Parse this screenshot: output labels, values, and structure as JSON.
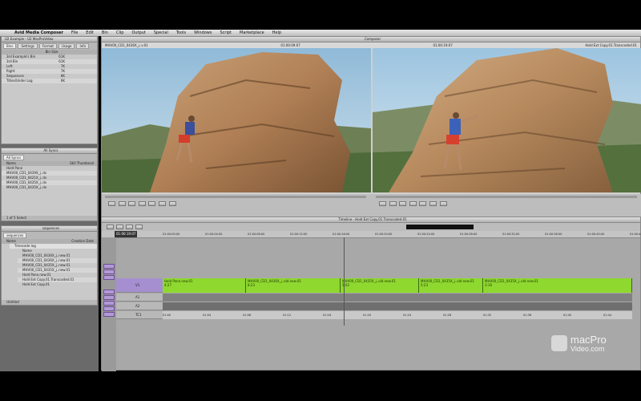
{
  "app": {
    "name": "Avid Media Composer",
    "menus": [
      "File",
      "Edit",
      "Bin",
      "Clip",
      "Output",
      "Special",
      "Tools",
      "Windows",
      "Script",
      "Marketplace",
      "Help"
    ]
  },
  "project_panel": {
    "title": "U2 Example - U2 MacProVideo",
    "tabs": [
      "Bins",
      "Settings",
      "Format",
      "Usage",
      "Info"
    ],
    "header": "Bin Size",
    "rows": [
      {
        "label": "3rd Example's Bin",
        "value": "61K"
      },
      {
        "label": "3rd Bin",
        "value": "61K"
      },
      {
        "label": "Left",
        "value": "7K"
      },
      {
        "label": "Right",
        "value": "7K"
      },
      {
        "label": "Sequences",
        "value": "8K"
      },
      {
        "label": "Titles/Under Log",
        "value": "6K"
      }
    ]
  },
  "bin1": {
    "title": "All Syncs",
    "tab": "All Syncs",
    "header_name": "Name",
    "header_extra": "Still Thumbnail",
    "items": [
      "Hold Pane",
      "MHV00_CD1_0439X_j..dv",
      "MHV00_CD1_0421X_j..dv",
      "MHV00_CD1_0435X_j..dv",
      "MHV00_CD1_0435X_j..dv"
    ],
    "footer": "1 of 5 Select"
  },
  "bin2": {
    "title": "sequences",
    "tab": "sequences",
    "header_name": "Name",
    "header_extra": "Creation Date",
    "group_label": "Timecode log",
    "subheader": "Name",
    "items": [
      "MHV00_CD1_0436X_j..new.01",
      "MHV00_CD1_0436X_j..new.01",
      "MHV00_CD1_0435X_j..new.01",
      "MHV00_CD1_0435X_j..new.01",
      "Hold Pane.new.01",
      "Hold Ext Copy.01.Transcoded.01",
      "Hold Ext Copy.01"
    ],
    "footer": "Untitled"
  },
  "composer": {
    "title": "Composer",
    "source_label": "MHV00_CD1_0436X_j..v.01",
    "source_tc": "01:00:09:07",
    "record_tc": "01:00:19:07",
    "record_label": "Hold Ext Copy.01.Transcoded.01"
  },
  "timeline": {
    "title": "Timeline - Hold Ext Copy.01 Transcoded.01",
    "timecode": "01:00:19:07",
    "ruler": [
      "01:00:00:00",
      "01:00:04:00",
      "01:00:08:00",
      "01:00:12:00",
      "01:00:16:00",
      "01:00:20:00",
      "01:00:24:00",
      "01:00:28:00",
      "01:00:32:00",
      "01:00:36:00",
      "01:00:40:00",
      "01:00:44:00"
    ],
    "tracks": [
      "V1",
      "A1",
      "A2",
      "TC1"
    ],
    "clips": [
      {
        "name": "Hold Pane.new.01",
        "dur": "4:27"
      },
      {
        "name": "MHV00_CD1_0436X_j..old.new.01",
        "dur": "8:23"
      },
      {
        "name": "MHV00_CD1_0435X_j..old.new.01",
        "dur": "5:02"
      },
      {
        "name": "MHV00_CD1_0435X_j..old.new.01",
        "dur": "5:23"
      },
      {
        "name": "MHV00_CD1_0435X_j..old.new.01",
        "dur": "3:16"
      }
    ],
    "tc_ruler": [
      "01:00",
      "01:04",
      "01:08",
      "01:12",
      "01:16",
      "01:20",
      "01:24",
      "01:28",
      "01:32",
      "01:36",
      "01:40",
      "01:44"
    ]
  },
  "watermark": {
    "line1": "macPro",
    "line2": "Video.com"
  },
  "colors": {
    "clip": "#8fd830",
    "panel": "#c9c9c9",
    "track_select": "#b39ad6"
  }
}
